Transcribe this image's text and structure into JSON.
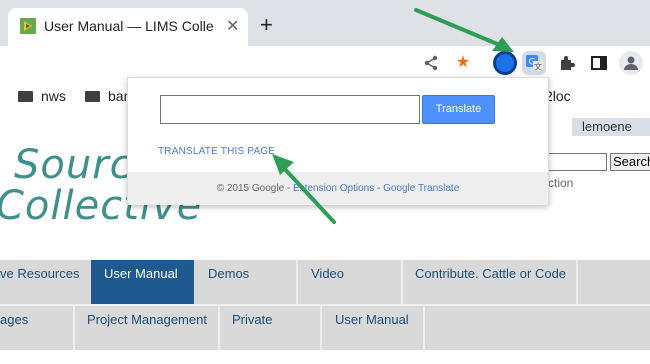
{
  "browser": {
    "tab_title": "User Manual — LIMS Collective",
    "tab_close": "✕",
    "new_tab": "+"
  },
  "bookmarks": [
    {
      "label": "nws"
    },
    {
      "label": "bar"
    }
  ],
  "bookmark_fragment": "2loc",
  "page": {
    "user": "lemoene",
    "logo_line1": "Source",
    "logo_line2": "Collective",
    "search_button": "Search",
    "search_caption_fragment": "ction",
    "nav_row1": [
      {
        "label": "ve Resources",
        "active": false
      },
      {
        "label": "User Manual",
        "active": true
      },
      {
        "label": "Demos",
        "active": false
      },
      {
        "label": "Video",
        "active": false
      },
      {
        "label": "Contribute. Cattle or Code",
        "active": false
      }
    ],
    "nav_row2": [
      {
        "label": "ages"
      },
      {
        "label": "Project Management"
      },
      {
        "label": "Private"
      },
      {
        "label": "User Manual"
      }
    ]
  },
  "popup": {
    "translate_button": "Translate",
    "translate_page_link": "TRANSLATE THIS PAGE",
    "footer_copyright": "© 2015 Google",
    "footer_sep1": " - ",
    "footer_ext_options": "Extension Options",
    "footer_sep2": " - ",
    "footer_google_translate": "Google Translate"
  },
  "colors": {
    "nav_active": "#1e5a8f",
    "link_blue": "#4a7bd0",
    "arrow_green": "#2e9e56",
    "logo_teal": "#3f8f8a"
  }
}
